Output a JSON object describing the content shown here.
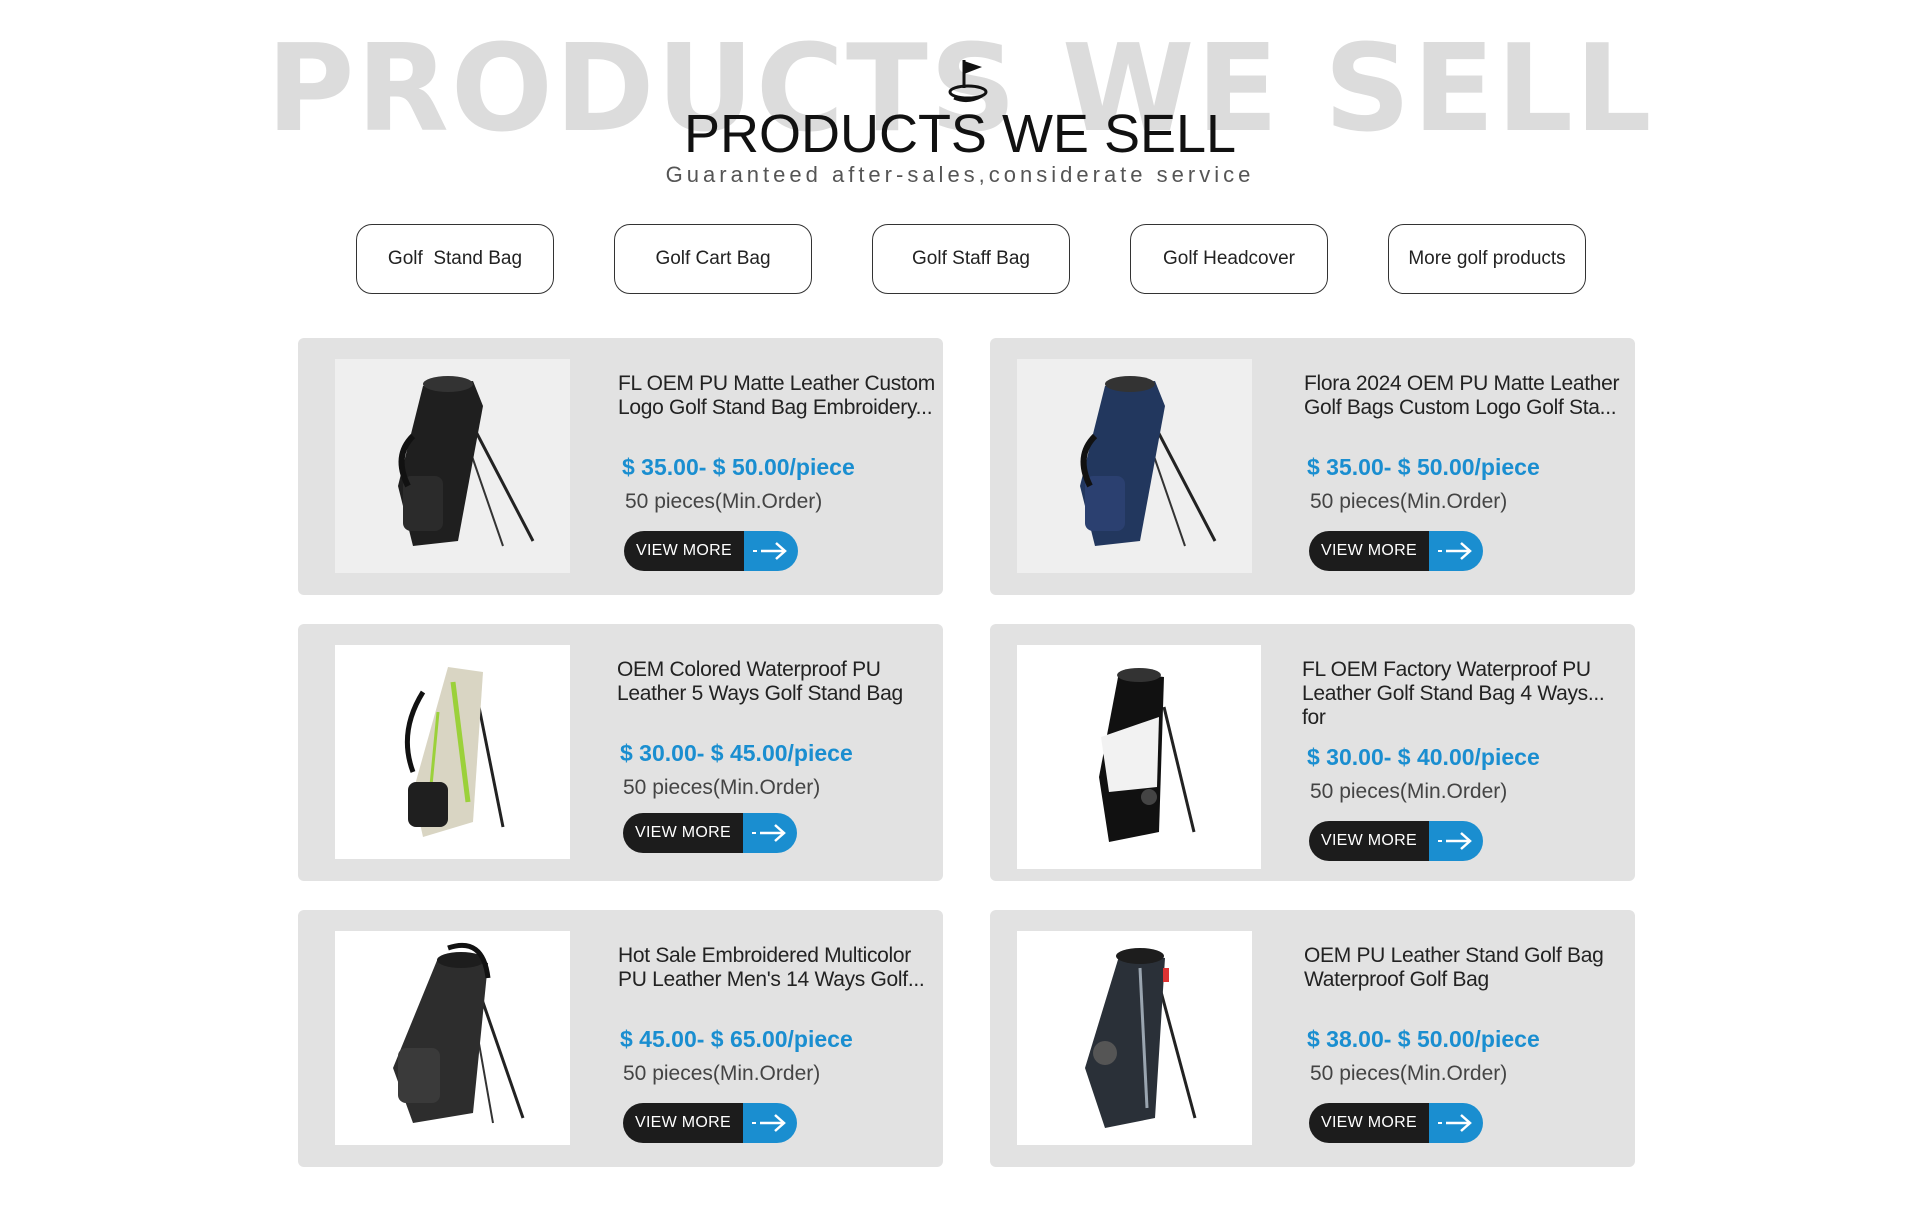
{
  "header": {
    "bg_title": "PRODUCTS WE SELL",
    "title": "PRODUCTS WE SELL",
    "subtitle": "Guaranteed after-sales,considerate service",
    "logo_icon": "golf-flag-icon"
  },
  "categories": [
    {
      "label": "Golf  Stand Bag"
    },
    {
      "label": "Golf Cart Bag"
    },
    {
      "label": "Golf Staff Bag"
    },
    {
      "label": "Golf Headcover"
    },
    {
      "label": "More golf products"
    }
  ],
  "products": [
    {
      "title": "FL OEM PU Matte Leather Custom Logo Golf Stand Bag Embroidery...",
      "price": "$ 35.00- $ 50.00/piece",
      "moq": "50 pieces(Min.Order)",
      "button": "VIEW MORE",
      "image_icon": "golf-stand-bag-black-icon",
      "bag_color": "#1f1f1f"
    },
    {
      "title": "Flora 2024 OEM PU Matte Leather Golf Bags Custom Logo Golf Sta...",
      "price": "$ 35.00- $ 50.00/piece",
      "moq": "50 pieces(Min.Order)",
      "button": "VIEW MORE",
      "image_icon": "golf-stand-bag-navy-icon",
      "bag_color": "#22375e"
    },
    {
      "title": "OEM Colored Waterproof PU Leather 5 Ways Golf Stand Bag",
      "price": "$ 30.00- $ 45.00/piece",
      "moq": "50 pieces(Min.Order)",
      "button": "VIEW MORE",
      "image_icon": "golf-stand-bag-cream-green-icon",
      "bag_color": "#d9d5c3"
    },
    {
      "title": "FL OEM Factory Waterproof PU Leather Golf Stand Bag 4 Ways... for",
      "price": "$ 30.00- $ 40.00/piece",
      "moq": "50 pieces(Min.Order)",
      "button": "VIEW MORE",
      "image_icon": "golf-stand-bag-black-white-icon",
      "bag_color": "#111111"
    },
    {
      "title": "Hot Sale Embroidered Multicolor PU Leather Men's 14 Ways Golf...",
      "price": "$ 45.00- $ 65.00/piece",
      "moq": "50 pieces(Min.Order)",
      "button": "VIEW MORE",
      "image_icon": "golf-stand-bag-charcoal-icon",
      "bag_color": "#2d2d2d"
    },
    {
      "title": "OEM PU Leather Stand Golf Bag Waterproof Golf Bag",
      "price": "$ 38.00- $ 50.00/piece",
      "moq": "50 pieces(Min.Order)",
      "button": "VIEW MORE",
      "image_icon": "golf-stand-bag-slate-icon",
      "bag_color": "#2a3038"
    }
  ],
  "colors": {
    "accent": "#1a8ed0",
    "button_dark": "#1c1c1c",
    "card_bg": "#e2e2e2",
    "bg_title": "#dcdcdc"
  }
}
